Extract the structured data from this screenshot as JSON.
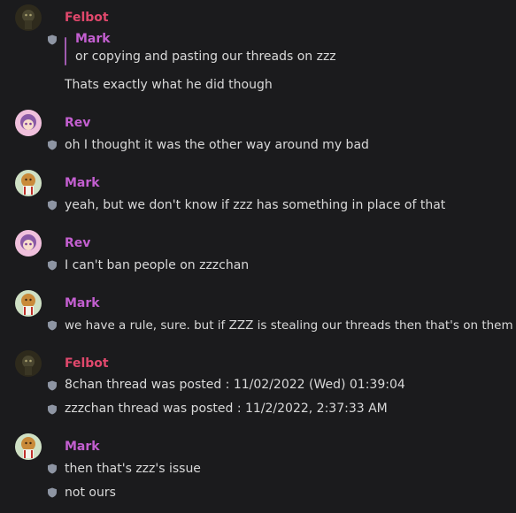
{
  "colors": {
    "background": "#1b1b1d",
    "felbot": "#e0486c",
    "mark": "#c35fd0",
    "rev": "#c35fd0",
    "text": "#d9d9d9",
    "shield": "#8e95a3",
    "quote_bar": "#a05ab0"
  },
  "messages": [
    {
      "author": "Felbot",
      "avatar_icon": "felbot-avatar-icon",
      "quote": {
        "author": "Mark",
        "text": "or copying and pasting our threads on zzz"
      },
      "lines": [
        "Thats exactly what he did though"
      ]
    },
    {
      "author": "Rev",
      "avatar_icon": "rev-avatar-icon",
      "lines": [
        "oh I thought it was the other way around my bad"
      ]
    },
    {
      "author": "Mark",
      "avatar_icon": "mark-avatar-icon",
      "lines": [
        "yeah, but we don't know if zzz has something in place of that"
      ]
    },
    {
      "author": "Rev",
      "avatar_icon": "rev-avatar-icon",
      "lines": [
        "I can't ban people on zzzchan"
      ]
    },
    {
      "author": "Mark",
      "avatar_icon": "mark-avatar-icon",
      "lines": [
        "we have a rule, sure. but if ZZZ is stealing our threads then that's on them"
      ]
    },
    {
      "author": "Felbot",
      "avatar_icon": "felbot-avatar-icon",
      "lines": [
        "8chan thread was posted : 11/02/2022 (Wed) 01:39:04",
        "zzzchan thread was posted : 11/2/2022, 2:37:33 AM"
      ]
    },
    {
      "author": "Mark",
      "avatar_icon": "mark-avatar-icon",
      "lines": [
        "then that's zzz's issue",
        "not ours"
      ]
    }
  ]
}
